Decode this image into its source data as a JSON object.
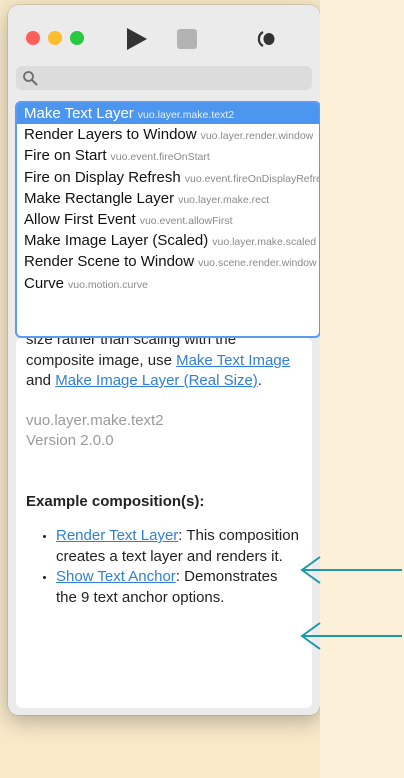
{
  "toolbar": {
    "run": "run-icon",
    "stop": "stop-icon",
    "show_hide": "show-events-icon"
  },
  "search": {
    "value": "",
    "icon": "search-icon"
  },
  "node_list": [
    {
      "title": "Make Text Layer",
      "class": "vuo.layer.make.text2",
      "selected": true
    },
    {
      "title": "Render Layers to Window",
      "class": "vuo.layer.render.window"
    },
    {
      "title": "Fire on Start",
      "class": "vuo.event.fireOnStart"
    },
    {
      "title": "Fire on Display Refresh",
      "class": "vuo.event.fireOnDisplayRefresh"
    },
    {
      "title": "Make Rectangle Layer",
      "class": "vuo.layer.make.rect"
    },
    {
      "title": "Allow First Event",
      "class": "vuo.event.allowFirst"
    },
    {
      "title": "Make Image Layer (Scaled)",
      "class": "vuo.layer.make.scaled"
    },
    {
      "title": "Render Scene to Window",
      "class": "vuo.scene.render.window"
    },
    {
      "title": "Curve",
      "class": "vuo.motion.curve"
    }
  ],
  "doc": {
    "para_start": "size rather than scaling with the composite image, use ",
    "link1": "Make Text Image",
    "and": " and ",
    "link2": "Make Image Layer (Real Size)",
    "period": ".",
    "class_name": "vuo.layer.make.text2",
    "version": "Version 2.0.0",
    "examples_heading": "Example composition(s):",
    "examples": [
      {
        "link": "Render Text Layer",
        "desc": ": This composition creates a text layer and renders it."
      },
      {
        "link": "Show Text Anchor",
        "desc": ": Demonstrates the 9 text anchor options."
      }
    ]
  },
  "colors": {
    "selection": "#4d96f0",
    "link": "#2f7fd8",
    "annotation_arrow": "#1b9aaa",
    "background": "#f8e9c9"
  }
}
